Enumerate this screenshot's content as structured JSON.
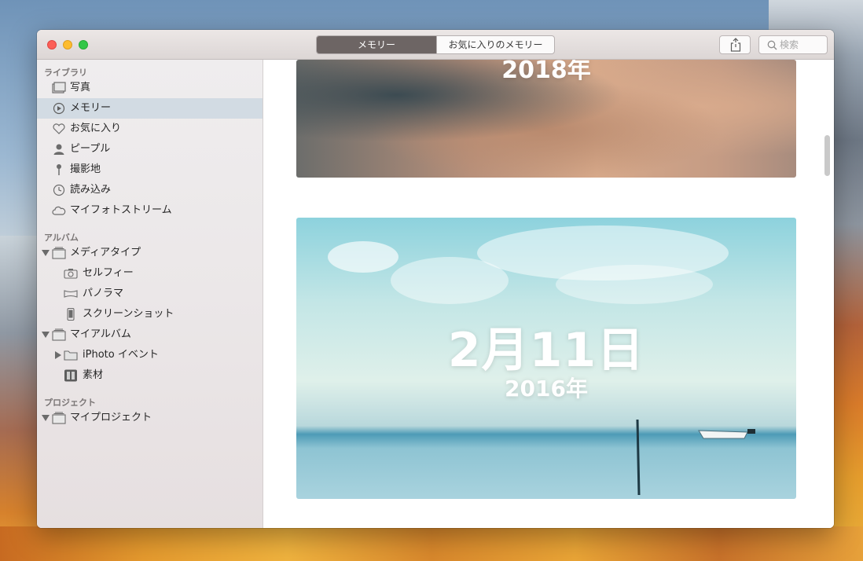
{
  "window": {
    "segmented": [
      "メモリー",
      "お気に入りのメモリー"
    ],
    "search_placeholder": "検索"
  },
  "sidebar": {
    "sections": [
      {
        "title": "ライブラリ"
      },
      {
        "title": "アルバム"
      },
      {
        "title": "プロジェクト"
      }
    ],
    "library": [
      {
        "label": "写真",
        "icon": "photos-icon"
      },
      {
        "label": "メモリー",
        "icon": "memories-icon",
        "selected": true
      },
      {
        "label": "お気に入り",
        "icon": "heart-icon"
      },
      {
        "label": "ピープル",
        "icon": "person-icon"
      },
      {
        "label": "撮影地",
        "icon": "pin-icon"
      },
      {
        "label": "読み込み",
        "icon": "clock-icon"
      },
      {
        "label": "マイフォトストリーム",
        "icon": "cloud-icon"
      }
    ],
    "albums": [
      {
        "label": "メディアタイプ",
        "icon": "album-stack-icon"
      },
      {
        "label": "セルフィー",
        "icon": "camera-icon"
      },
      {
        "label": "パノラマ",
        "icon": "panorama-icon"
      },
      {
        "label": "スクリーンショット",
        "icon": "phone-icon"
      },
      {
        "label": "マイアルバム",
        "icon": "album-stack-icon"
      },
      {
        "label": "iPhoto イベント",
        "icon": "folder-icon"
      },
      {
        "label": "素材",
        "icon": "album-thumb-icon"
      }
    ],
    "projects": [
      {
        "label": "マイプロジェクト",
        "icon": "album-stack-icon"
      }
    ]
  },
  "memories": [
    {
      "title": "",
      "subtitle": "2018年"
    },
    {
      "title": "2月11日",
      "subtitle": "2016年"
    }
  ]
}
